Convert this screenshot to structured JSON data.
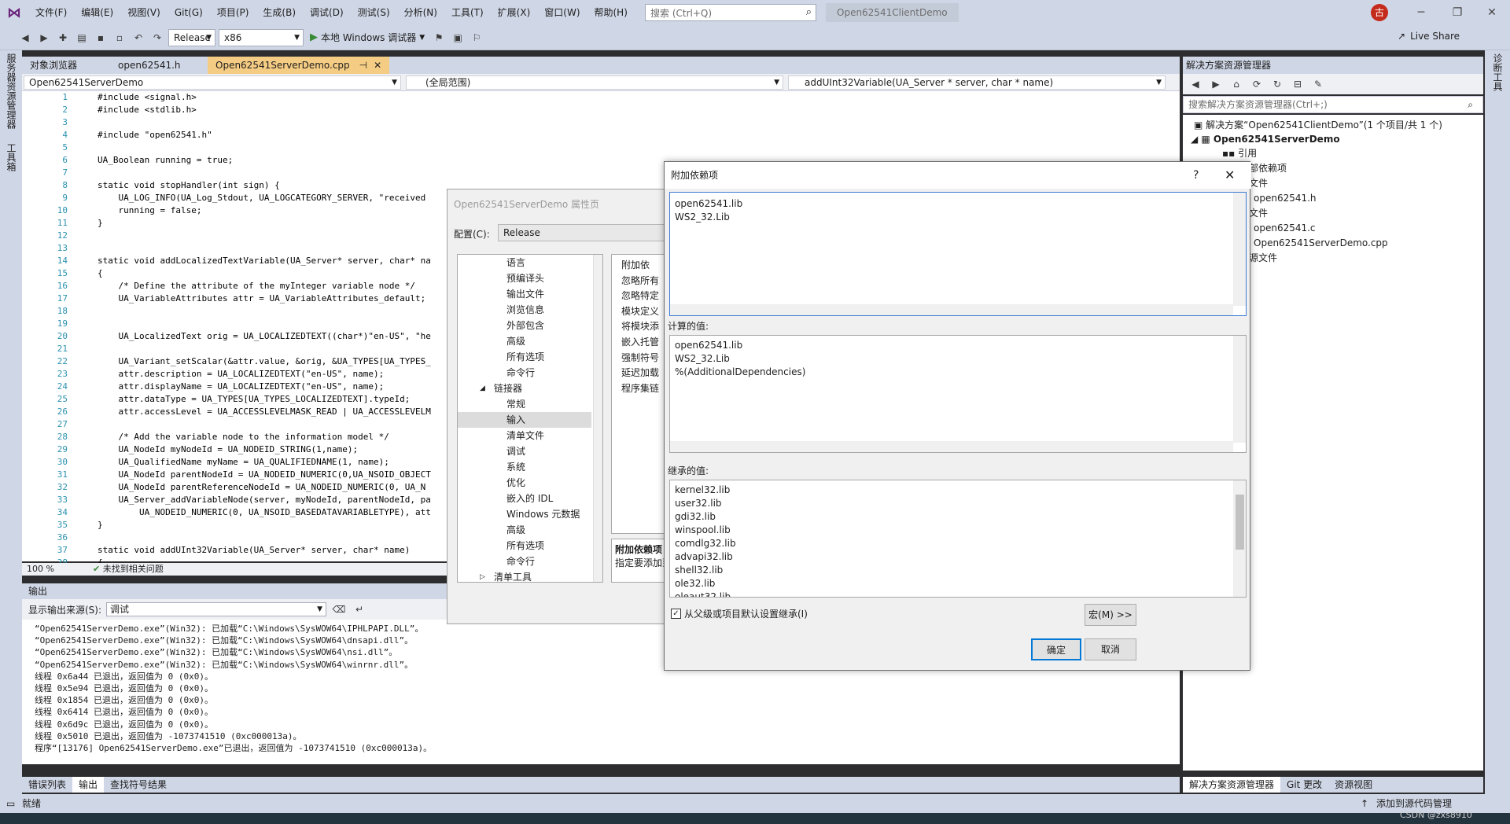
{
  "menubar": {
    "items": [
      "文件(F)",
      "编辑(E)",
      "视图(V)",
      "Git(G)",
      "项目(P)",
      "生成(B)",
      "调试(D)",
      "测试(S)",
      "分析(N)",
      "工具(T)",
      "扩展(X)",
      "窗口(W)",
      "帮助(H)"
    ],
    "search_placeholder": "搜索 (Ctrl+Q)",
    "solution_name": "Open62541ClientDemo",
    "account_initial": "古"
  },
  "toolbar": {
    "config": "Release",
    "platform": "x86",
    "run_label": "本地 Windows 调试器",
    "live_share": "Live Share"
  },
  "left_strip": {
    "server_explorer": "服务器资源管理器",
    "toolbox": "工具箱"
  },
  "right_strip": {
    "diagnostics": "诊断工具"
  },
  "editor": {
    "tabs": [
      "对象浏览器",
      "open62541.h",
      "Open62541ServerDemo.cpp"
    ],
    "nav": {
      "project": "Open62541ServerDemo",
      "scope": "(全局范围)",
      "member": "addUInt32Variable(UA_Server * server, char * name)"
    },
    "lines": [
      {
        "n": "1",
        "t": "#include <signal.h>"
      },
      {
        "n": "2",
        "t": "#include <stdlib.h>"
      },
      {
        "n": "3",
        "t": ""
      },
      {
        "n": "4",
        "t": "#include \"open62541.h\""
      },
      {
        "n": "5",
        "t": ""
      },
      {
        "n": "6",
        "t": "UA_Boolean running = true;"
      },
      {
        "n": "7",
        "t": ""
      },
      {
        "n": "8",
        "t": "static void stopHandler(int sign) {"
      },
      {
        "n": "9",
        "t": "    UA_LOG_INFO(UA_Log_Stdout, UA_LOGCATEGORY_SERVER, \"received"
      },
      {
        "n": "10",
        "t": "    running = false;"
      },
      {
        "n": "11",
        "t": "}"
      },
      {
        "n": "12",
        "t": ""
      },
      {
        "n": "13",
        "t": ""
      },
      {
        "n": "14",
        "t": "static void addLocalizedTextVariable(UA_Server* server, char* na"
      },
      {
        "n": "15",
        "t": "{"
      },
      {
        "n": "16",
        "t": "    /* Define the attribute of the myInteger variable node */"
      },
      {
        "n": "17",
        "t": "    UA_VariableAttributes attr = UA_VariableAttributes_default;"
      },
      {
        "n": "18",
        "t": ""
      },
      {
        "n": "19",
        "t": ""
      },
      {
        "n": "20",
        "t": "    UA_LocalizedText orig = UA_LOCALIZEDTEXT((char*)\"en-US\", \"he"
      },
      {
        "n": "21",
        "t": ""
      },
      {
        "n": "22",
        "t": "    UA_Variant_setScalar(&attr.value, &orig, &UA_TYPES[UA_TYPES_"
      },
      {
        "n": "23",
        "t": "    attr.description = UA_LOCALIZEDTEXT(\"en-US\", name);"
      },
      {
        "n": "24",
        "t": "    attr.displayName = UA_LOCALIZEDTEXT(\"en-US\", name);"
      },
      {
        "n": "25",
        "t": "    attr.dataType = UA_TYPES[UA_TYPES_LOCALIZEDTEXT].typeId;"
      },
      {
        "n": "26",
        "t": "    attr.accessLevel = UA_ACCESSLEVELMASK_READ | UA_ACCESSLEVELM"
      },
      {
        "n": "27",
        "t": ""
      },
      {
        "n": "28",
        "t": "    /* Add the variable node to the information model */"
      },
      {
        "n": "29",
        "t": "    UA_NodeId myNodeId = UA_NODEID_STRING(1,name);"
      },
      {
        "n": "30",
        "t": "    UA_QualifiedName myName = UA_QUALIFIEDNAME(1, name);"
      },
      {
        "n": "31",
        "t": "    UA_NodeId parentNodeId = UA_NODEID_NUMERIC(0,UA_NSOID_OBJECT"
      },
      {
        "n": "32",
        "t": "    UA_NodeId parentReferenceNodeId = UA_NODEID_NUMERIC(0, UA_N"
      },
      {
        "n": "33",
        "t": "    UA_Server_addVariableNode(server, myNodeId, parentNodeId, pa"
      },
      {
        "n": "34",
        "t": "        UA_NODEID_NUMERIC(0, UA_NSOID_BASEDATAVARIABLETYPE), att"
      },
      {
        "n": "35",
        "t": "}"
      },
      {
        "n": "36",
        "t": ""
      },
      {
        "n": "37",
        "t": "static void addUInt32Variable(UA_Server* server, char* name)"
      },
      {
        "n": "38",
        "t": "{"
      }
    ],
    "zoom": "100 %",
    "issues": "未找到相关问题"
  },
  "output": {
    "title": "输出",
    "source_label": "显示输出来源(S):",
    "source": "调试",
    "lines": [
      "“Open62541ServerDemo.exe”(Win32): 已加载“C:\\Windows\\SysWOW64\\IPHLPAPI.DLL”。",
      "“Open62541ServerDemo.exe”(Win32): 已加载“C:\\Windows\\SysWOW64\\dnsapi.dll”。",
      "“Open62541ServerDemo.exe”(Win32): 已加载“C:\\Windows\\SysWOW64\\nsi.dll”。",
      "“Open62541ServerDemo.exe”(Win32): 已加载“C:\\Windows\\SysWOW64\\winrnr.dll”。",
      "线程 0x6a44 已退出，返回值为 0 (0x0)。",
      "线程 0x5e94 已退出，返回值为 0 (0x0)。",
      "线程 0x1854 已退出，返回值为 0 (0x0)。",
      "线程 0x6414 已退出，返回值为 0 (0x0)。",
      "线程 0x6d9c 已退出，返回值为 0 (0x0)。",
      "线程 0x5010 已退出，返回值为 -1073741510 (0xc000013a)。",
      "程序“[13176] Open62541ServerDemo.exe”已退出，返回值为 -1073741510 (0xc000013a)。"
    ],
    "tabs": [
      "错误列表",
      "输出",
      "查找符号结果"
    ]
  },
  "solution_explorer": {
    "title": "解决方案资源管理器",
    "search_placeholder": "搜索解决方案资源管理器(Ctrl+;)",
    "solution": "解决方案“Open62541ClientDemo”(1 个项目/共 1 个)",
    "project": "Open62541ServerDemo",
    "nodes": [
      "引用",
      "部依赖项",
      "文件",
      "open62541.h",
      "文件",
      "open62541.c",
      "Open62541ServerDemo.cpp",
      "源文件"
    ],
    "tabs": [
      "解决方案资源管理器",
      "Git 更改",
      "资源视图"
    ]
  },
  "status": {
    "ready": "就绪",
    "add_source": "添加到源代码管理",
    "watermark": "CSDN @zxs8910"
  },
  "props_dialog": {
    "title": "Open62541ServerDemo 属性页",
    "config_label": "配置(C):",
    "config": "Release",
    "tree": [
      "语言",
      "预编译头",
      "输出文件",
      "浏览信息",
      "外部包含",
      "高级",
      "所有选项",
      "命令行",
      "链接器",
      "常规",
      "输入",
      "清单文件",
      "调试",
      "系统",
      "优化",
      "嵌入的 IDL",
      "Windows 元数据",
      "高级",
      "所有选项",
      "命令行",
      "清单工具"
    ],
    "grid": [
      "附加依",
      "忽略所有",
      "忽略特定",
      "模块定义",
      "将模块添",
      "嵌入托管",
      "强制符号",
      "延迟加载",
      "程序集链"
    ],
    "desc_title": "附加依赖项",
    "desc_text": "指定要添加到"
  },
  "deps_dialog": {
    "title": "附加依赖项",
    "help": "?",
    "edit_lines": [
      "open62541.lib",
      "WS2_32.Lib"
    ],
    "computed_label": "计算的值:",
    "computed": [
      "open62541.lib",
      "WS2_32.Lib",
      "%(AdditionalDependencies)"
    ],
    "inherited_label": "继承的值:",
    "inherited": [
      "kernel32.lib",
      "user32.lib",
      "gdi32.lib",
      "winspool.lib",
      "comdlg32.lib",
      "advapi32.lib",
      "shell32.lib",
      "ole32.lib",
      "oleaut32.lib"
    ],
    "inherit_checkbox": "从父级或项目默认设置继承(I)",
    "macro_button": "宏(M) >>",
    "ok": "确定",
    "cancel": "取消"
  }
}
